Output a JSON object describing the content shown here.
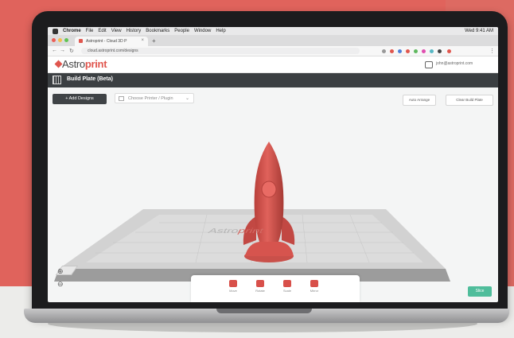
{
  "browser": {
    "menubar": {
      "items": [
        "Chrome",
        "File",
        "Edit",
        "View",
        "History",
        "Bookmarks",
        "People",
        "Window",
        "Help"
      ],
      "clock": "Wed 9:41 AM"
    },
    "tab": {
      "title": "Astroprint - Cloud 3D P"
    },
    "address": "cloud.astroprint.com/designs"
  },
  "app": {
    "logo": {
      "prefix": "Astro",
      "accent": "print"
    },
    "user_email": "john@astroprint.com",
    "page_title": "Build Plate (Beta)",
    "toolbar": {
      "add_designs_label": "+ Add Designs",
      "printer_select_label": "Choose Printer / Plugin",
      "btn_arrange": "Auto Arrange",
      "btn_clear": "Clear Build Plate"
    },
    "bottom_dock": [
      {
        "label": "Move",
        "icon": "move-icon"
      },
      {
        "label": "Rotate",
        "icon": "rotate-icon"
      },
      {
        "label": "Scale",
        "icon": "scale-icon"
      },
      {
        "label": "Mirror",
        "icon": "mirror-icon"
      }
    ],
    "slice_button_label": "Slice",
    "floor_logo": {
      "prefix": "Astro",
      "accent": "print"
    },
    "colors": {
      "accent": "#e0564e",
      "model": "#d8504a",
      "topbar": "#3b3f42",
      "slice": "#4fbd9b",
      "wall": "#e0635c"
    }
  }
}
